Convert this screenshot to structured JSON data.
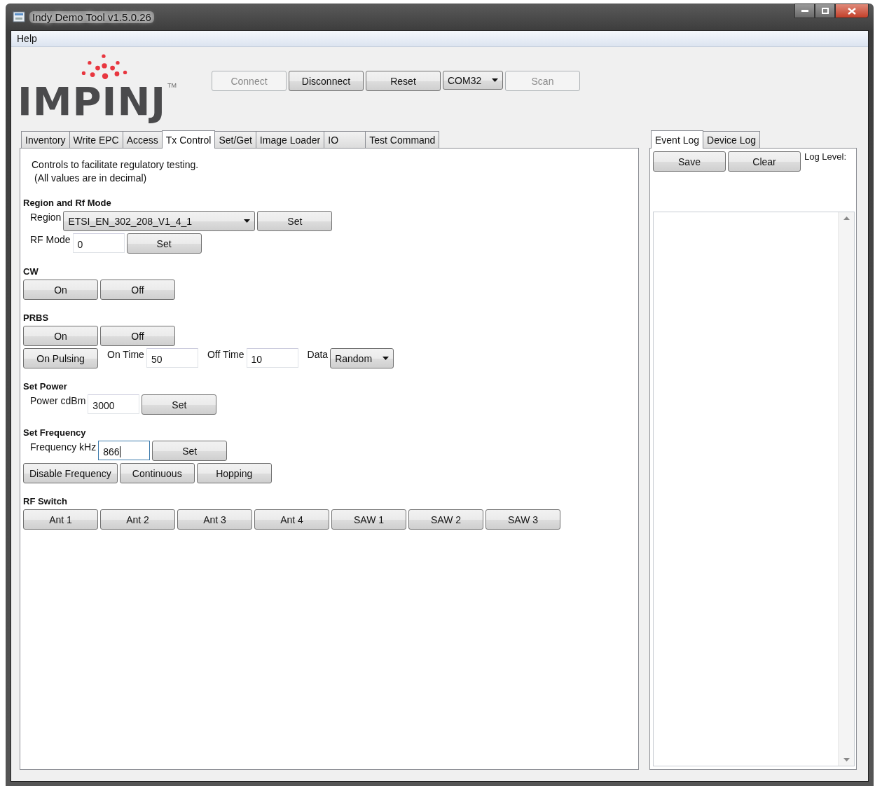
{
  "window": {
    "title": "Indy Demo Tool v1.5.0.26"
  },
  "menu": [
    "Help"
  ],
  "logo": {
    "text": "IMPINJ",
    "mark": "TM"
  },
  "toolbar": [
    {
      "kind": "button",
      "label": "Connect",
      "disabled": true
    },
    {
      "kind": "button",
      "label": "Disconnect",
      "disabled": false
    },
    {
      "kind": "button",
      "label": "Reset",
      "disabled": false
    },
    {
      "kind": "select",
      "label": "COM32"
    },
    {
      "kind": "button",
      "label": "Scan",
      "disabled": true
    }
  ],
  "tabs": [
    {
      "label": "Inventory",
      "selected": false
    },
    {
      "label": "Write EPC",
      "selected": false
    },
    {
      "label": "Access",
      "selected": false
    },
    {
      "label": "Tx Control",
      "selected": true
    },
    {
      "label": "Set/Get",
      "selected": false
    },
    {
      "label": "Image Loader",
      "selected": false
    },
    {
      "label": "IO",
      "selected": false
    },
    {
      "label": "Test Command",
      "selected": false
    }
  ],
  "description": [
    "Controls to facilitate regulatory testing.",
    "(All values are in decimal)"
  ],
  "sections": [
    {
      "title": "Region and Rf Mode",
      "lines": [
        {
          "controls": [
            {
              "kind": "label",
              "text": "Region"
            },
            {
              "kind": "select",
              "text": "ETSI_EN_302_208_V1_4_1"
            },
            {
              "kind": "button",
              "text": "Set"
            }
          ]
        },
        {
          "controls": [
            {
              "kind": "label",
              "text": "RF Mode"
            },
            {
              "kind": "input",
              "text": "0"
            },
            {
              "kind": "button",
              "text": "Set"
            }
          ]
        }
      ]
    },
    {
      "title": "CW",
      "lines": [
        {
          "controls": [
            {
              "kind": "button",
              "text": "On"
            },
            {
              "kind": "button",
              "text": "Off"
            }
          ]
        }
      ]
    },
    {
      "title": "PRBS",
      "lines": [
        {
          "controls": [
            {
              "kind": "button",
              "text": "On"
            },
            {
              "kind": "button",
              "text": "Off"
            }
          ]
        },
        {
          "controls": [
            {
              "kind": "button",
              "text": "On Pulsing"
            },
            {
              "kind": "label",
              "text": "On Time"
            },
            {
              "kind": "input",
              "text": "50"
            },
            {
              "kind": "label",
              "text": "Off Time"
            },
            {
              "kind": "input",
              "text": "10"
            },
            {
              "kind": "label",
              "text": "Data"
            },
            {
              "kind": "dropdown",
              "text": "Random"
            }
          ]
        }
      ]
    },
    {
      "title": "Set Power",
      "lines": [
        {
          "controls": [
            {
              "kind": "label",
              "text": "Power cdBm"
            },
            {
              "kind": "input",
              "text": "3000"
            },
            {
              "kind": "button",
              "text": "Set"
            }
          ]
        }
      ]
    },
    {
      "title": "Set Frequency",
      "lines": [
        {
          "controls": [
            {
              "kind": "label",
              "text": "Frequency kHz"
            },
            {
              "kind": "input",
              "text": "866",
              "focused": true
            },
            {
              "kind": "button",
              "text": "Set"
            }
          ]
        },
        {
          "controls": [
            {
              "kind": "button",
              "text": "Disable Frequency"
            },
            {
              "kind": "button",
              "text": "Continuous"
            },
            {
              "kind": "button",
              "text": "Hopping"
            }
          ]
        }
      ]
    },
    {
      "title": "RF Switch",
      "lines": [
        {
          "controls": [
            {
              "kind": "button",
              "text": "Ant 1"
            },
            {
              "kind": "button",
              "text": "Ant 2"
            },
            {
              "kind": "button",
              "text": "Ant 3"
            },
            {
              "kind": "button",
              "text": "Ant 4"
            },
            {
              "kind": "button",
              "text": "SAW 1"
            },
            {
              "kind": "button",
              "text": "SAW 2"
            },
            {
              "kind": "button",
              "text": "SAW 3"
            }
          ]
        }
      ]
    }
  ],
  "log_tabs": [
    {
      "label": "Event Log",
      "selected": true
    },
    {
      "label": "Device Log",
      "selected": false
    }
  ],
  "log_buttons": [
    "Save",
    "Clear"
  ],
  "log_level_label": "Log Level:"
}
